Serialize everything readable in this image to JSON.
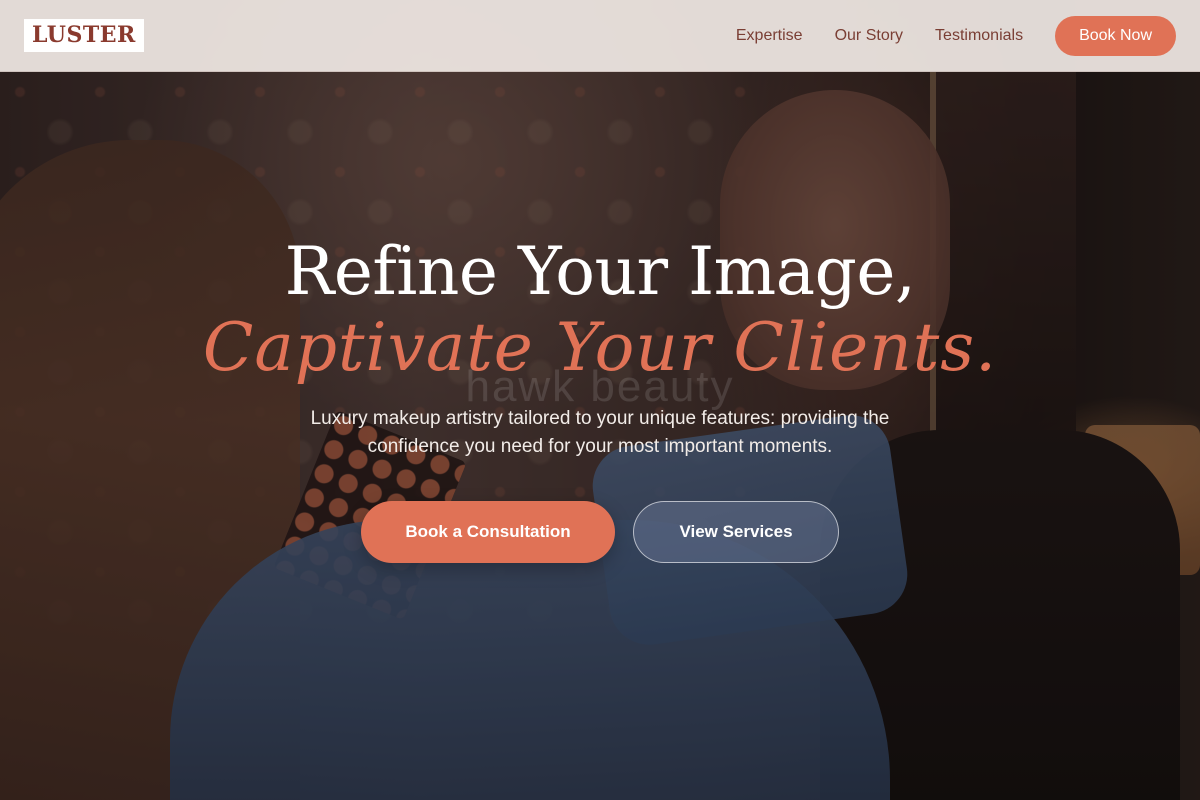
{
  "header": {
    "logo": "LUSTER",
    "nav": {
      "expertise": "Expertise",
      "our_story": "Our Story",
      "testimonials": "Testimonials"
    },
    "book_now": "Book Now"
  },
  "hero": {
    "headline_line1": "Refine Your Image,",
    "headline_line2": "Captivate Your Clients.",
    "watermark": "hawk beauty",
    "subtext": "Luxury makeup artistry tailored to your unique features: providing the confidence you need for your most important moments.",
    "primary_cta": "Book a Consultation",
    "secondary_cta": "View Services"
  },
  "colors": {
    "accent": "#e07256",
    "logo_text": "#8a3a2e",
    "nav_text": "#7a3e34",
    "header_bg": "#f0e8e4"
  }
}
